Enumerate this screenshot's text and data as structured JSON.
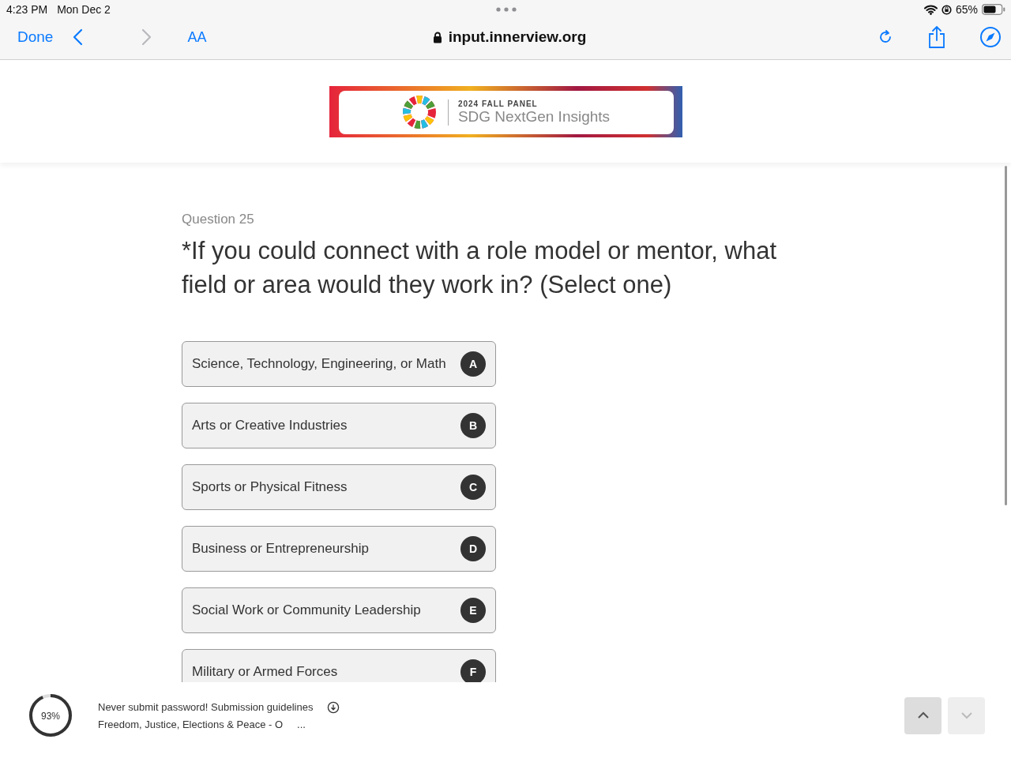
{
  "status_bar": {
    "time": "4:23 PM",
    "date": "Mon Dec 2",
    "battery": "65%"
  },
  "browser": {
    "done": "Done",
    "text_size": "AA",
    "url": "input.innerview.org"
  },
  "banner": {
    "eyebrow": "2024 FALL PANEL",
    "title": "SDG NextGen Insights"
  },
  "question": {
    "number": "Question 25",
    "text": "*If you could connect with a role model or mentor, what field or area would they work in? (Select one)"
  },
  "options": [
    {
      "label": "Science, Technology, Engineering, or Math",
      "key": "A",
      "selected": false
    },
    {
      "label": "Arts or Creative Industries",
      "key": "B",
      "selected": false
    },
    {
      "label": "Sports or Physical Fitness",
      "key": "C",
      "selected": false
    },
    {
      "label": "Business or Entrepreneurship",
      "key": "D",
      "selected": false
    },
    {
      "label": "Social Work or Community Leadership",
      "key": "E",
      "selected": false
    },
    {
      "label": "Military or Armed Forces",
      "key": "F",
      "selected": false
    }
  ],
  "footer": {
    "progress": {
      "level": 0.93,
      "reading": "93%"
    },
    "notice": "Never submit password! Submission guidelines",
    "topic": "Freedom, Justice, Elections & Peace - O",
    "more": "...",
    "nav": [
      {
        "kind": "up",
        "disabled": false
      },
      {
        "kind": "down",
        "disabled": true
      }
    ]
  }
}
